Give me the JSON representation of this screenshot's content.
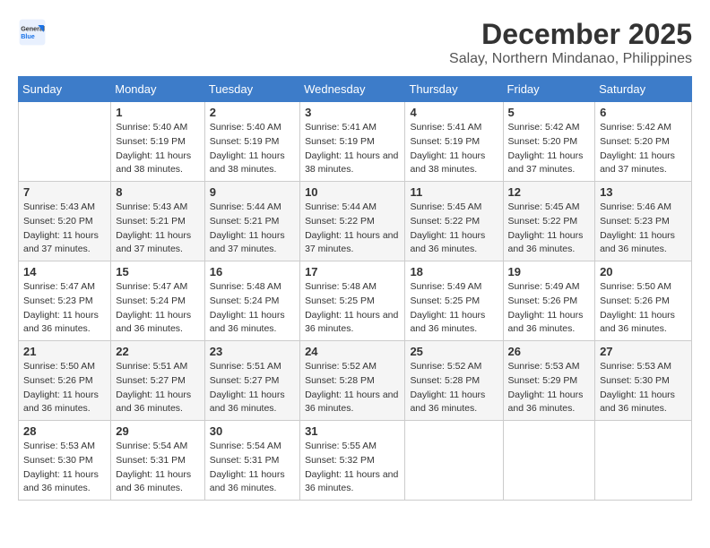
{
  "header": {
    "logo_line1": "General",
    "logo_line2": "Blue",
    "month": "December 2025",
    "location": "Salay, Northern Mindanao, Philippines"
  },
  "days_of_week": [
    "Sunday",
    "Monday",
    "Tuesday",
    "Wednesday",
    "Thursday",
    "Friday",
    "Saturday"
  ],
  "weeks": [
    [
      {
        "day": "",
        "sunrise": "",
        "sunset": "",
        "daylight": ""
      },
      {
        "day": "1",
        "sunrise": "Sunrise: 5:40 AM",
        "sunset": "Sunset: 5:19 PM",
        "daylight": "Daylight: 11 hours and 38 minutes."
      },
      {
        "day": "2",
        "sunrise": "Sunrise: 5:40 AM",
        "sunset": "Sunset: 5:19 PM",
        "daylight": "Daylight: 11 hours and 38 minutes."
      },
      {
        "day": "3",
        "sunrise": "Sunrise: 5:41 AM",
        "sunset": "Sunset: 5:19 PM",
        "daylight": "Daylight: 11 hours and 38 minutes."
      },
      {
        "day": "4",
        "sunrise": "Sunrise: 5:41 AM",
        "sunset": "Sunset: 5:19 PM",
        "daylight": "Daylight: 11 hours and 38 minutes."
      },
      {
        "day": "5",
        "sunrise": "Sunrise: 5:42 AM",
        "sunset": "Sunset: 5:20 PM",
        "daylight": "Daylight: 11 hours and 37 minutes."
      },
      {
        "day": "6",
        "sunrise": "Sunrise: 5:42 AM",
        "sunset": "Sunset: 5:20 PM",
        "daylight": "Daylight: 11 hours and 37 minutes."
      }
    ],
    [
      {
        "day": "7",
        "sunrise": "Sunrise: 5:43 AM",
        "sunset": "Sunset: 5:20 PM",
        "daylight": "Daylight: 11 hours and 37 minutes."
      },
      {
        "day": "8",
        "sunrise": "Sunrise: 5:43 AM",
        "sunset": "Sunset: 5:21 PM",
        "daylight": "Daylight: 11 hours and 37 minutes."
      },
      {
        "day": "9",
        "sunrise": "Sunrise: 5:44 AM",
        "sunset": "Sunset: 5:21 PM",
        "daylight": "Daylight: 11 hours and 37 minutes."
      },
      {
        "day": "10",
        "sunrise": "Sunrise: 5:44 AM",
        "sunset": "Sunset: 5:22 PM",
        "daylight": "Daylight: 11 hours and 37 minutes."
      },
      {
        "day": "11",
        "sunrise": "Sunrise: 5:45 AM",
        "sunset": "Sunset: 5:22 PM",
        "daylight": "Daylight: 11 hours and 36 minutes."
      },
      {
        "day": "12",
        "sunrise": "Sunrise: 5:45 AM",
        "sunset": "Sunset: 5:22 PM",
        "daylight": "Daylight: 11 hours and 36 minutes."
      },
      {
        "day": "13",
        "sunrise": "Sunrise: 5:46 AM",
        "sunset": "Sunset: 5:23 PM",
        "daylight": "Daylight: 11 hours and 36 minutes."
      }
    ],
    [
      {
        "day": "14",
        "sunrise": "Sunrise: 5:47 AM",
        "sunset": "Sunset: 5:23 PM",
        "daylight": "Daylight: 11 hours and 36 minutes."
      },
      {
        "day": "15",
        "sunrise": "Sunrise: 5:47 AM",
        "sunset": "Sunset: 5:24 PM",
        "daylight": "Daylight: 11 hours and 36 minutes."
      },
      {
        "day": "16",
        "sunrise": "Sunrise: 5:48 AM",
        "sunset": "Sunset: 5:24 PM",
        "daylight": "Daylight: 11 hours and 36 minutes."
      },
      {
        "day": "17",
        "sunrise": "Sunrise: 5:48 AM",
        "sunset": "Sunset: 5:25 PM",
        "daylight": "Daylight: 11 hours and 36 minutes."
      },
      {
        "day": "18",
        "sunrise": "Sunrise: 5:49 AM",
        "sunset": "Sunset: 5:25 PM",
        "daylight": "Daylight: 11 hours and 36 minutes."
      },
      {
        "day": "19",
        "sunrise": "Sunrise: 5:49 AM",
        "sunset": "Sunset: 5:26 PM",
        "daylight": "Daylight: 11 hours and 36 minutes."
      },
      {
        "day": "20",
        "sunrise": "Sunrise: 5:50 AM",
        "sunset": "Sunset: 5:26 PM",
        "daylight": "Daylight: 11 hours and 36 minutes."
      }
    ],
    [
      {
        "day": "21",
        "sunrise": "Sunrise: 5:50 AM",
        "sunset": "Sunset: 5:26 PM",
        "daylight": "Daylight: 11 hours and 36 minutes."
      },
      {
        "day": "22",
        "sunrise": "Sunrise: 5:51 AM",
        "sunset": "Sunset: 5:27 PM",
        "daylight": "Daylight: 11 hours and 36 minutes."
      },
      {
        "day": "23",
        "sunrise": "Sunrise: 5:51 AM",
        "sunset": "Sunset: 5:27 PM",
        "daylight": "Daylight: 11 hours and 36 minutes."
      },
      {
        "day": "24",
        "sunrise": "Sunrise: 5:52 AM",
        "sunset": "Sunset: 5:28 PM",
        "daylight": "Daylight: 11 hours and 36 minutes."
      },
      {
        "day": "25",
        "sunrise": "Sunrise: 5:52 AM",
        "sunset": "Sunset: 5:28 PM",
        "daylight": "Daylight: 11 hours and 36 minutes."
      },
      {
        "day": "26",
        "sunrise": "Sunrise: 5:53 AM",
        "sunset": "Sunset: 5:29 PM",
        "daylight": "Daylight: 11 hours and 36 minutes."
      },
      {
        "day": "27",
        "sunrise": "Sunrise: 5:53 AM",
        "sunset": "Sunset: 5:30 PM",
        "daylight": "Daylight: 11 hours and 36 minutes."
      }
    ],
    [
      {
        "day": "28",
        "sunrise": "Sunrise: 5:53 AM",
        "sunset": "Sunset: 5:30 PM",
        "daylight": "Daylight: 11 hours and 36 minutes."
      },
      {
        "day": "29",
        "sunrise": "Sunrise: 5:54 AM",
        "sunset": "Sunset: 5:31 PM",
        "daylight": "Daylight: 11 hours and 36 minutes."
      },
      {
        "day": "30",
        "sunrise": "Sunrise: 5:54 AM",
        "sunset": "Sunset: 5:31 PM",
        "daylight": "Daylight: 11 hours and 36 minutes."
      },
      {
        "day": "31",
        "sunrise": "Sunrise: 5:55 AM",
        "sunset": "Sunset: 5:32 PM",
        "daylight": "Daylight: 11 hours and 36 minutes."
      },
      {
        "day": "",
        "sunrise": "",
        "sunset": "",
        "daylight": ""
      },
      {
        "day": "",
        "sunrise": "",
        "sunset": "",
        "daylight": ""
      },
      {
        "day": "",
        "sunrise": "",
        "sunset": "",
        "daylight": ""
      }
    ]
  ]
}
